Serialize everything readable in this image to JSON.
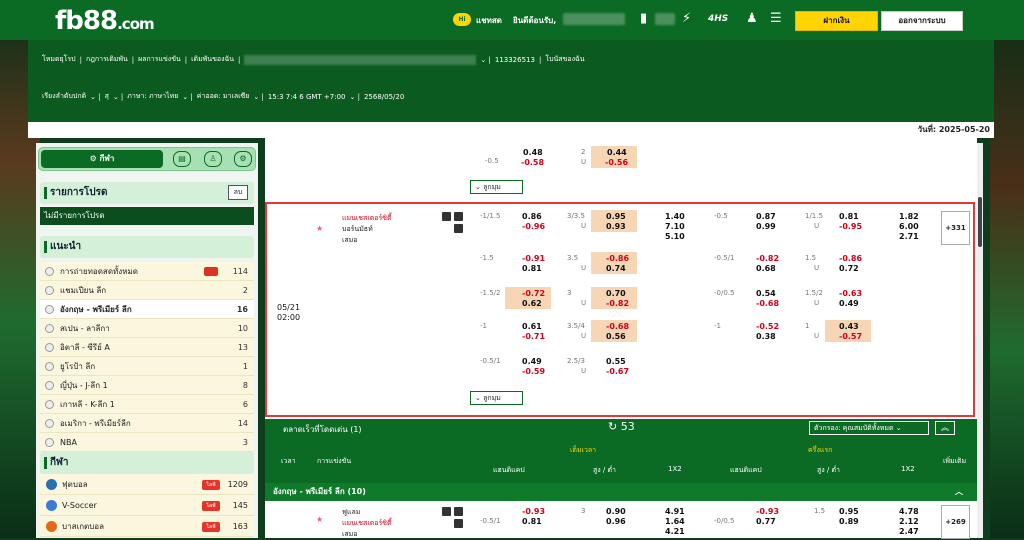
{
  "header": {
    "logo": "fb88",
    "logo_domain": ".com",
    "chat": "แชทสด",
    "welcome": "ยินดีต้อนรับ,",
    "deposit": "ฝากเงิน",
    "logout": "ออกจากระบบ"
  },
  "subbar": {
    "row1": [
      "โหมดยุโรป",
      "กฎการเดิมพัน",
      "ผลการแข่งขัน",
      "เดิมพันของฉัน"
    ],
    "account": "113326513",
    "bonus": "โบนัสของฉัน",
    "row2": [
      "เรียงลำดับปกติ",
      "สุ",
      "ภาษา: ภาษาไทย",
      "ค่าออด: มาเลเซีย",
      "15:3 7:4 6 GMT +7:00",
      "2568/05/20"
    ]
  },
  "date_label": "วันที่: 2025-05-20",
  "sidebar": {
    "sport_tab": "กีฬา",
    "betslip_title": "รายการโปรด",
    "betslip_btn": "ลบ",
    "no_bets": "ไม่มีรายการโปรด",
    "recommend_title": "แนะนำ",
    "leagues": [
      {
        "name": "การถ่ายทอดสดทั้งหมด",
        "count": "114"
      },
      {
        "name": "แชมเปียน ลีก",
        "count": "2"
      },
      {
        "name": "อังกฤษ - พรีเมียร์ ลีก",
        "count": "16"
      },
      {
        "name": "สเปน - ลาลีกา",
        "count": "10"
      },
      {
        "name": "อิตาลี - ซีรีย์ A",
        "count": "13"
      },
      {
        "name": "ยูโรป้า ลีก",
        "count": "1"
      },
      {
        "name": "ญี่ปุ่น - J-ลีก 1",
        "count": "8"
      },
      {
        "name": "เกาหลี - K-ลีก 1",
        "count": "6"
      },
      {
        "name": "อเมริกา - พรีเมียร์ลีก",
        "count": "14"
      },
      {
        "name": "NBA",
        "count": "3"
      }
    ],
    "sports_title": "กีฬา",
    "sports": [
      {
        "name": "ฟุตบอล",
        "count": "1209",
        "color": "#2a6fb0"
      },
      {
        "name": "V-Soccer",
        "count": "145",
        "color": "#3a7bd5"
      },
      {
        "name": "บาสเกตบอล",
        "count": "163",
        "color": "#e06a1b"
      }
    ],
    "live_tag": "ไลฟ์"
  },
  "top_block": {
    "hdp": "-0.5",
    "h_home": "0.48",
    "h_away": "-0.58",
    "ou": "2",
    "ou_u": "U",
    "o_over": "0.44",
    "o_under": "-0.56",
    "more": "ลูกมุม"
  },
  "match": {
    "date": "05/21",
    "time": "02:00",
    "home": "แมนเชสเตอร์ซิตี้",
    "away": "บอร์นมัธท์",
    "draw": "เสมอ",
    "more": "ลูกมุม",
    "plus": "+331",
    "rows": [
      {
        "fh": "-1/1.5",
        "fh1": "0.86",
        "fh2": "-0.96",
        "ou": "3/3.5",
        "ou1": "0.95",
        "ou2": "0.93",
        "x1": "1.40",
        "x2": "7.10",
        "x3": "5.10",
        "hh": "-0.5",
        "hh1": "0.87",
        "hh2": "0.99",
        "hou": "1/1.5",
        "hou1": "0.81",
        "hou2": "-0.95",
        "hx1": "1.82",
        "hx2": "6.00",
        "hx3": "2.71"
      },
      {
        "fh": "-1.5",
        "fh1": "-0.91",
        "fh2": "0.81",
        "ou": "3.5",
        "ou1": "-0.86",
        "ou2": "0.74",
        "hh": "-0.5/1",
        "hh1": "-0.82",
        "hh2": "0.68",
        "hou": "1.5",
        "hou1": "-0.86",
        "hou2": "0.72"
      },
      {
        "fh": "-1.5/2",
        "fh1": "-0.72",
        "fh2": "0.62",
        "ou": "3",
        "ou1": "0.70",
        "ou2": "-0.82",
        "hh": "-0/0.5",
        "hh1": "0.54",
        "hh2": "-0.68",
        "hou": "1.5/2",
        "hou1": "-0.63",
        "hou2": "0.49"
      },
      {
        "fh": "-1",
        "fh1": "0.61",
        "fh2": "-0.71",
        "ou": "3.5/4",
        "ou1": "-0.68",
        "ou2": "0.56",
        "hh": "-1",
        "hh1": "-0.52",
        "hh2": "0.38",
        "hou": "1",
        "hou1": "0.43",
        "hou2": "-0.57"
      },
      {
        "fh": "-0.5/1",
        "fh1": "0.49",
        "fh2": "-0.59",
        "ou": "2.5/3",
        "ou1": "0.55",
        "ou2": "-0.67"
      }
    ]
  },
  "fast": {
    "title": "ตลาดเร็วที่โดดเด่น (1)",
    "count": "53",
    "filter": "ตัวกรอง: คุณสมบัติทั้งหมด"
  },
  "table_header": {
    "time": "เวลา",
    "event": "การแข่งขัน",
    "full": "เต็มเวลา",
    "half": "ครึ่งแรก",
    "hdp": "แฮนดิแคป",
    "ou": "สูง / ต่ำ",
    "x12": "1X2",
    "more": "เพิ่มเติม"
  },
  "league_bar": "อังกฤษ - พรีเมียร์ ลีก (10)",
  "next_match": {
    "home": "ฟูแลม",
    "away": "แมนเชสเตอร์ซิตี้",
    "draw": "เสมอ",
    "fh": "-0.5/1",
    "fh1": "-0.93",
    "fh2": "0.81",
    "ou": "3",
    "ou1": "0.90",
    "ou2": "0.96",
    "x1": "4.91",
    "x2": "1.64",
    "x3": "4.21",
    "hh": "-0/0.5",
    "hh1": "-0.93",
    "hh2": "0.77",
    "hou": "1.5",
    "hou1": "0.95",
    "hou2": "0.89",
    "hx1": "4.78",
    "hx2": "2.12",
    "hx3": "2.47",
    "plus": "+269"
  }
}
